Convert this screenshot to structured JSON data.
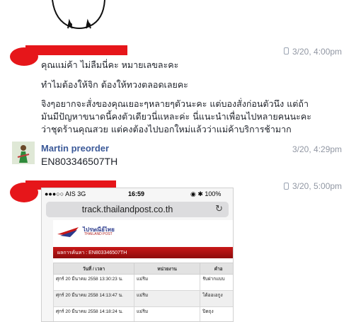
{
  "messages": [
    {
      "timestamp": "3/20, 4:00pm",
      "lines": [
        "คุณแม่ค้า ไม่ลืมนี่คะ หมายเลขละคะ",
        "ทำไมต้องให้จิก ต้องให้ทวงตลอดเลยคะ",
        "จิงๆอยากจะสั่งของคุณเยอะๆหลายๆตัวนะคะ แต่บองสั่งก่อนตัวนึง แต่ถ้า",
        "มันมีปัญหาขนาดนี้คงตัวเดียวนี่แหละค่ะ นี่แนะนำเพื่อนไปหลายคนนะคะ",
        "ว่าชุดร้านคุณสวย แต่คงต้องไปบอกใหม่แล้วว่าแม่ค้าบริการช้ามาก"
      ]
    },
    {
      "sender": "Martin preorder",
      "timestamp": "3/20, 4:29pm",
      "text": "EN803346507TH"
    },
    {
      "timestamp": "3/20, 5:00pm"
    }
  ],
  "attachment": {
    "statusbar": {
      "carrier": "●●●○○ AIS  3G",
      "time": "16:59",
      "battery": "◉ ✱ 100%"
    },
    "url": "track.thailandpost.co.th",
    "logo_text": "ไปรษณีย์ไทย",
    "logo_sub": "THAILAND POST",
    "banner": "ผลการค้นหา : EN803346507TH",
    "columns": [
      "วันที่ / เวลา",
      "หน่วยงาน",
      "คำอ"
    ],
    "rows": [
      [
        "ศุกร์ 20 มีนาคม 2558 13:30:23 น.",
        "แม่ริม",
        "รับฝากแบบ"
      ],
      [
        "ศุกร์ 20 มีนาคม 2558 14:13:47 น.",
        "แม่ริม",
        "ได้ออเอกูง"
      ],
      [
        "ศุกร์ 20 มีนาคม 2558 14:18:24 น.",
        "แม่ริม",
        "ปิดถุง"
      ]
    ]
  }
}
